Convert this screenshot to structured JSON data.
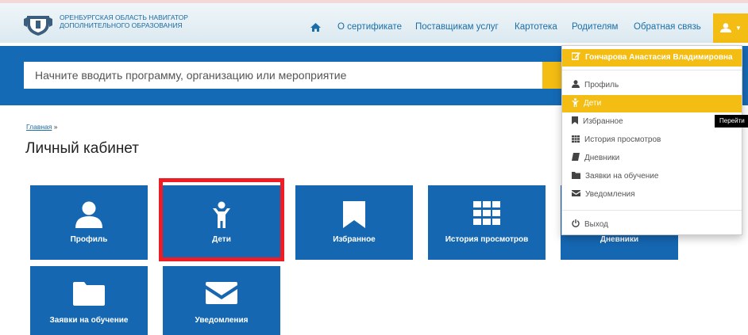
{
  "header": {
    "logo_text": "ОРЕНБУРГСКАЯ ОБЛАСТЬ НАВИГАТОР ДОПОЛНИТЕЛЬНОГО ОБРАЗОВАНИЯ",
    "nav": [
      "О сертификате",
      "Поставщикам услуг",
      "Картотека",
      "Родителям",
      "Обратная связь"
    ]
  },
  "search": {
    "placeholder": "Начните вводить программу, организацию или мероприятие"
  },
  "breadcrumb": {
    "home": "Главная",
    "separator": "»"
  },
  "page_title": "Личный кабинет",
  "tiles": [
    "Профиль",
    "Дети",
    "Избранное",
    "История просмотров",
    "Дневники",
    "Заявки на обучение",
    "Уведомления"
  ],
  "dropdown": {
    "user_name": "Гончарова Анастасия Владимировна",
    "items": [
      "Профиль",
      "Дети",
      "Избранное",
      "История просмотров",
      "Дневники",
      "Заявки на обучение",
      "Уведомления"
    ],
    "logout": "Выход"
  },
  "tooltip": "Перейти",
  "colors": {
    "brand_blue": "#1567b2",
    "accent_yellow": "#f3bd13",
    "highlight_red": "#ee1c24"
  }
}
